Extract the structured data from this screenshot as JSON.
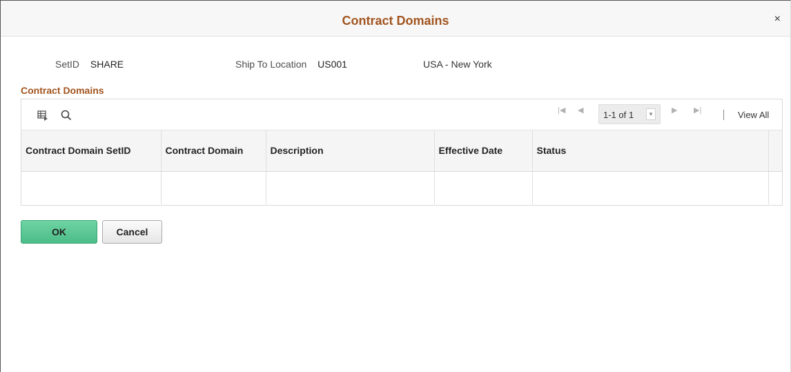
{
  "modal": {
    "title": "Contract Domains",
    "close_label": "×"
  },
  "header_fields": {
    "setid_label": "SetID",
    "setid_value": "SHARE",
    "ship_to_label": "Ship To Location",
    "ship_to_value": "US001",
    "ship_to_description": "USA - New York"
  },
  "section": {
    "title": "Contract Domains"
  },
  "grid": {
    "toolbar": {
      "personalize_icon": "grid-personalize-icon",
      "find_icon": "search-icon"
    },
    "pager": {
      "first": "|◀",
      "previous": "◀",
      "page_label": "1-1 of 1",
      "next": "▶",
      "last": "▶|",
      "view_all": "View All"
    },
    "columns": [
      "Contract Domain SetID",
      "Contract Domain",
      "Description",
      "Effective Date",
      "Status",
      ""
    ],
    "rows": [
      [
        "",
        "",
        "",
        "",
        "",
        ""
      ]
    ]
  },
  "buttons": {
    "ok": "OK",
    "cancel": "Cancel"
  },
  "colors": {
    "title_accent": "#a1541e",
    "ok_button": "#4cbd88"
  }
}
